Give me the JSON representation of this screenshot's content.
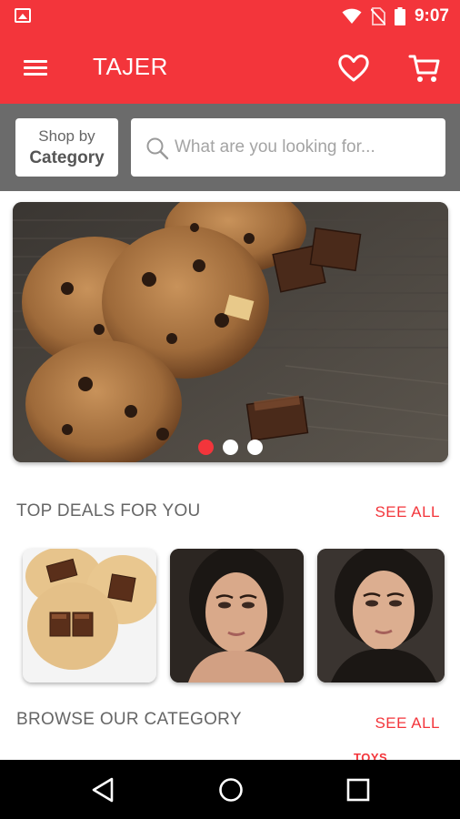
{
  "status_bar": {
    "time": "9:07",
    "icons": [
      "image-notification-icon",
      "wifi-icon",
      "no-sim-icon",
      "battery-icon"
    ]
  },
  "app_bar": {
    "title": "TAJER",
    "menu_icon": "menu-icon",
    "wishlist_icon": "heart-icon",
    "cart_icon": "cart-icon"
  },
  "search_band": {
    "shop_by_line1": "Shop by",
    "shop_by_line2": "Category",
    "search_placeholder": "What are you looking for...",
    "search_value": ""
  },
  "banner": {
    "dots_total": 3,
    "active_dot": 1
  },
  "top_deals": {
    "title": "TOP DEALS FOR YOU",
    "see_all": "SEE ALL"
  },
  "browse_category": {
    "title": "BROWSE OUR CATEGORY",
    "see_all": "SEE ALL",
    "partial_label": "TOYS"
  },
  "colors": {
    "accent": "#f3353b",
    "band": "#6b6b6b",
    "text_muted": "#666666"
  }
}
